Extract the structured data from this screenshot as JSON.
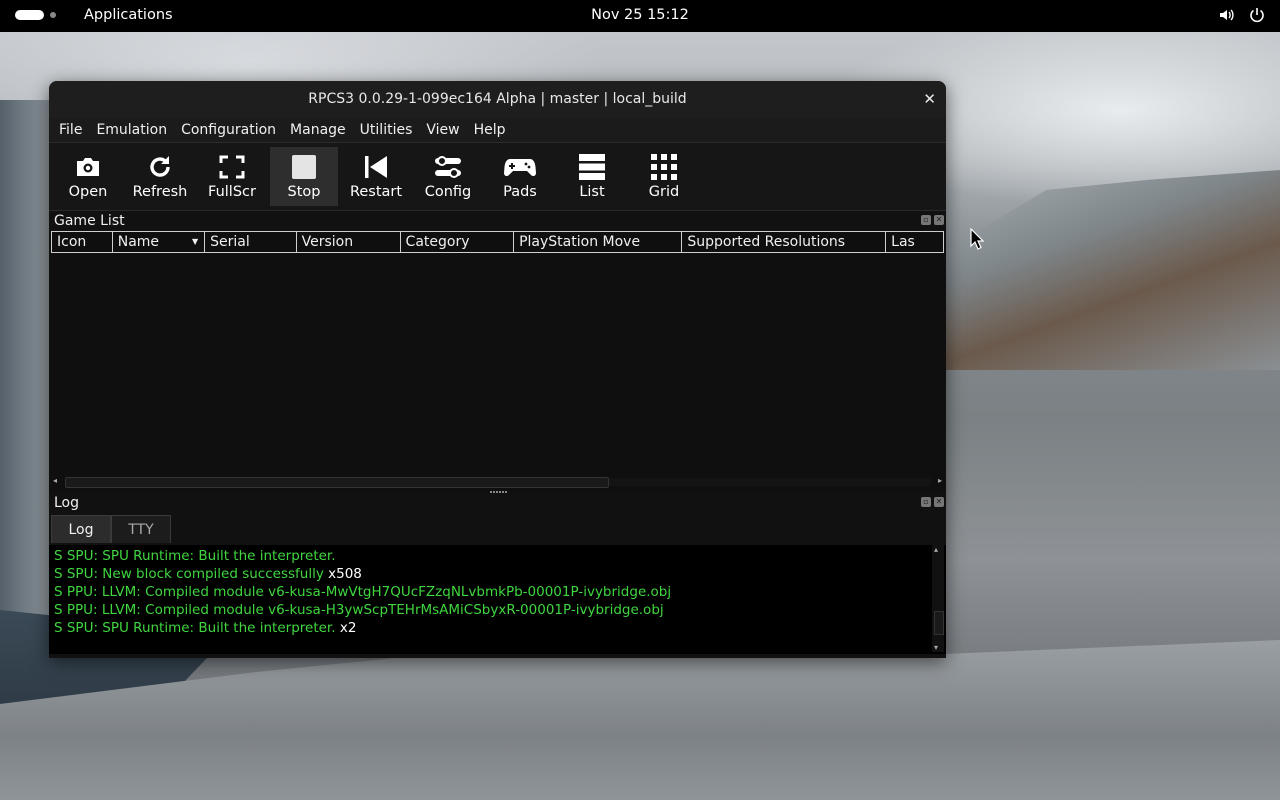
{
  "topbar": {
    "applications_label": "Applications",
    "clock": "Nov 25  15:12"
  },
  "window": {
    "title": "RPCS3 0.0.29-1-099ec164 Alpha | master | local_build",
    "close_glyph": "✕"
  },
  "menu": [
    "File",
    "Emulation",
    "Configuration",
    "Manage",
    "Utilities",
    "View",
    "Help"
  ],
  "toolbar": [
    {
      "label": "Open",
      "icon": "camera-icon"
    },
    {
      "label": "Refresh",
      "icon": "refresh-icon"
    },
    {
      "label": "FullScr",
      "icon": "fullscreen-icon"
    },
    {
      "label": "Stop",
      "icon": "stop-icon",
      "active": true
    },
    {
      "label": "Restart",
      "icon": "restart-icon"
    },
    {
      "label": "Config",
      "icon": "config-icon"
    },
    {
      "label": "Pads",
      "icon": "gamepad-icon"
    },
    {
      "label": "List",
      "icon": "list-icon"
    },
    {
      "label": "Grid",
      "icon": "grid-icon"
    }
  ],
  "game_list": {
    "title": "Game List",
    "columns": [
      "Icon",
      "Name",
      "Serial",
      "Version",
      "Category",
      "PlayStation Move",
      "Supported Resolutions",
      "Las"
    ]
  },
  "log": {
    "title": "Log",
    "tabs": [
      "Log",
      "TTY"
    ],
    "lines": [
      {
        "text": "S SPU: SPU Runtime: Built the interpreter.",
        "count": ""
      },
      {
        "text": "S SPU: New block compiled successfully",
        "count": "x508"
      },
      {
        "text": "S PPU: LLVM: Compiled module v6-kusa-MwVtgH7QUcFZzqNLvbmkPb-00001P-ivybridge.obj",
        "count": ""
      },
      {
        "text": "S PPU: LLVM: Compiled module v6-kusa-H3ywScpTEHrMsAMiCSbyxR-00001P-ivybridge.obj",
        "count": ""
      },
      {
        "text": "S SPU: SPU Runtime: Built the interpreter.",
        "count": "x2"
      }
    ]
  },
  "colors": {
    "log_green": "#3fd63f",
    "window_bg": "#111111",
    "topbar_bg": "#000000"
  }
}
